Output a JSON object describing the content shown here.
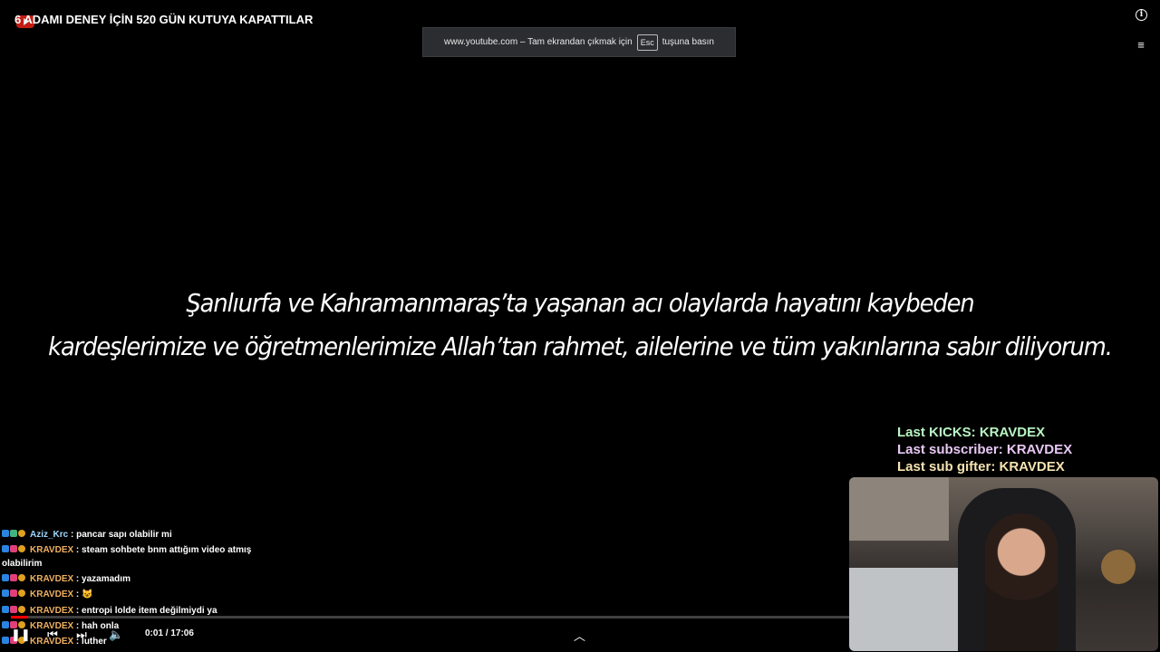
{
  "video": {
    "title": "6 ADAMI DENEY İÇİN 520 GÜN KUTUYA KAPATTILAR",
    "caption_line1": "Şanlıurfa ve Kahramanmaraş’ta yaşanan acı olaylarda hayatını kaybeden",
    "caption_line2": "kardeşlerimize ve öğretmenlerimize Allah’tan rahmet, ailelerine ve tüm yakınlarına sabır diliyorum.",
    "time_display": "0:01 / 17:06",
    "progress_fraction": 0.001
  },
  "fullscreen_notice": {
    "prefix": "www.youtube.com – Tam ekrandan çıkmak için",
    "key": "Esc",
    "suffix": "tuşuna basın"
  },
  "overlay_alerts": {
    "last_kicks": "Last KICKS: KRAVDEX",
    "last_subscriber": "Last subscriber: KRAVDEX",
    "last_sub_gifter": "Last sub gifter: KRAVDEX"
  },
  "chat": {
    "messages": [
      {
        "user": "Aziz_Krc",
        "text": "pancar sapı olabilir mi"
      },
      {
        "user": "KRAVDEX",
        "text": "steam sohbete bnm attığım video atmış olabilirim"
      },
      {
        "user": "KRAVDEX",
        "text": "yazamadım"
      },
      {
        "user": "KRAVDEX",
        "text": "😺"
      },
      {
        "user": "KRAVDEX",
        "text": "entropi lolde item değilmiydi ya"
      },
      {
        "user": "KRAVDEX",
        "text": "hah onla"
      },
      {
        "user": "KRAVDEX",
        "text": "luther"
      }
    ],
    "separator": " : "
  },
  "icons": {
    "info": "info-icon",
    "queue": "playlist-icon",
    "pause": "pause-icon",
    "previous": "previous-icon",
    "next": "next-icon",
    "volume": "volume-icon",
    "expand": "chevron-up-icon"
  },
  "colors": {
    "progress": "#ff0000",
    "alert_kicks": "#b9f5c2",
    "alert_sub": "#e8c8f5",
    "alert_gift": "#f5e3b0"
  }
}
